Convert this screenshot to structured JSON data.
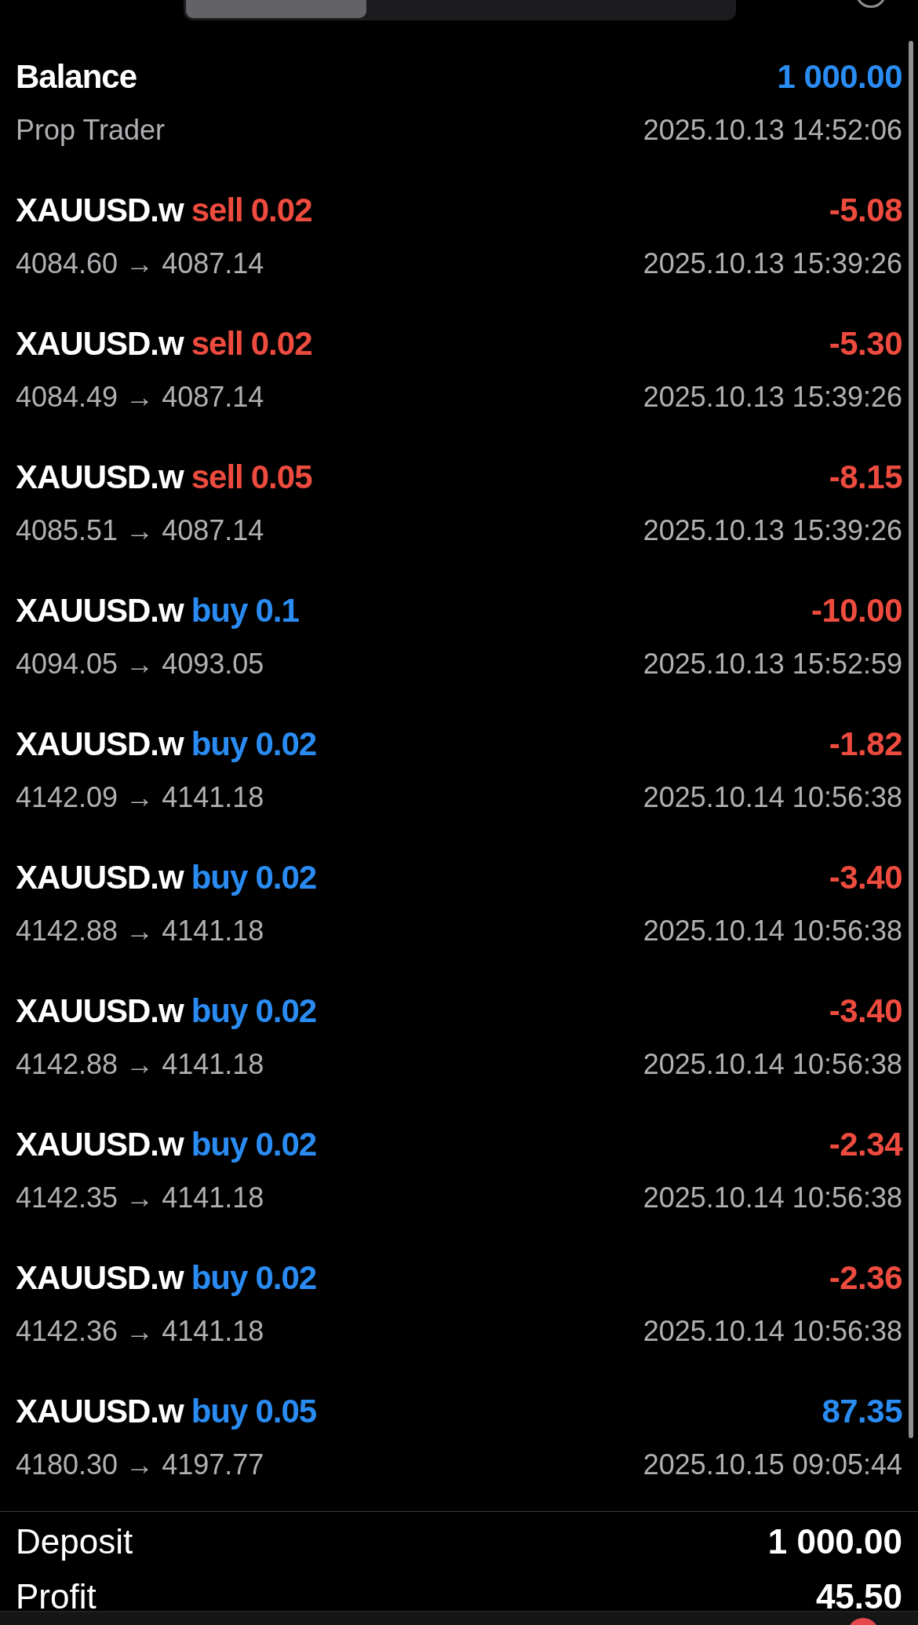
{
  "segments": [
    {
      "selected": true
    },
    {
      "selected": false
    },
    {
      "selected": false
    }
  ],
  "balance": {
    "label": "Balance",
    "amount": "1 000.00",
    "subtitle": "Prop Trader",
    "time": "2025.10.13 14:52:06"
  },
  "trades": [
    {
      "symbol": "XAUUSD.w",
      "kind": "sell",
      "side": "sell",
      "volume": "0.02",
      "prices": "4084.60 → 4087.14",
      "time": "2025.10.13 15:39:26",
      "profit": "-5.08",
      "color": "#ee4b3f"
    },
    {
      "symbol": "XAUUSD.w",
      "kind": "sell",
      "side": "sell",
      "volume": "0.02",
      "prices": "4084.49 → 4087.14",
      "time": "2025.10.13 15:39:26",
      "profit": "-5.30",
      "color": "#ee4b3f"
    },
    {
      "symbol": "XAUUSD.w",
      "kind": "sell",
      "side": "sell",
      "volume": "0.05",
      "prices": "4085.51 → 4087.14",
      "time": "2025.10.13 15:39:26",
      "profit": "-8.15",
      "color": "#ee4b3f"
    },
    {
      "symbol": "XAUUSD.w",
      "kind": "buy",
      "side": "buy",
      "volume": "0.1",
      "prices": "4094.05 → 4093.05",
      "time": "2025.10.13 15:52:59",
      "profit": "-10.00",
      "color": "#ee4b3f"
    },
    {
      "symbol": "XAUUSD.w",
      "kind": "buy",
      "side": "buy",
      "volume": "0.02",
      "prices": "4142.09 → 4141.18",
      "time": "2025.10.14 10:56:38",
      "profit": "-1.82",
      "color": "#ee4b3f"
    },
    {
      "symbol": "XAUUSD.w",
      "kind": "buy",
      "side": "buy",
      "volume": "0.02",
      "prices": "4142.88 → 4141.18",
      "time": "2025.10.14 10:56:38",
      "profit": "-3.40",
      "color": "#ee4b3f"
    },
    {
      "symbol": "XAUUSD.w",
      "kind": "buy",
      "side": "buy",
      "volume": "0.02",
      "prices": "4142.88 → 4141.18",
      "time": "2025.10.14 10:56:38",
      "profit": "-3.40",
      "color": "#ee4b3f"
    },
    {
      "symbol": "XAUUSD.w",
      "kind": "buy",
      "side": "buy",
      "volume": "0.02",
      "prices": "4142.35 → 4141.18",
      "time": "2025.10.14 10:56:38",
      "profit": "-2.34",
      "color": "#ee4b3f"
    },
    {
      "symbol": "XAUUSD.w",
      "kind": "buy",
      "side": "buy",
      "volume": "0.02",
      "prices": "4142.36 → 4141.18",
      "time": "2025.10.14 10:56:38",
      "profit": "-2.36",
      "color": "#ee4b3f"
    },
    {
      "symbol": "XAUUSD.w",
      "kind": "buy",
      "side": "buy",
      "volume": "0.05",
      "prices": "4180.30 → 4197.77",
      "time": "2025.10.15 09:05:44",
      "profit": "87.35",
      "color": "#2a8cf2"
    }
  ],
  "summary": [
    {
      "label": "Deposit",
      "value": "1 000.00"
    },
    {
      "label": "Profit",
      "value": "45.50"
    }
  ]
}
